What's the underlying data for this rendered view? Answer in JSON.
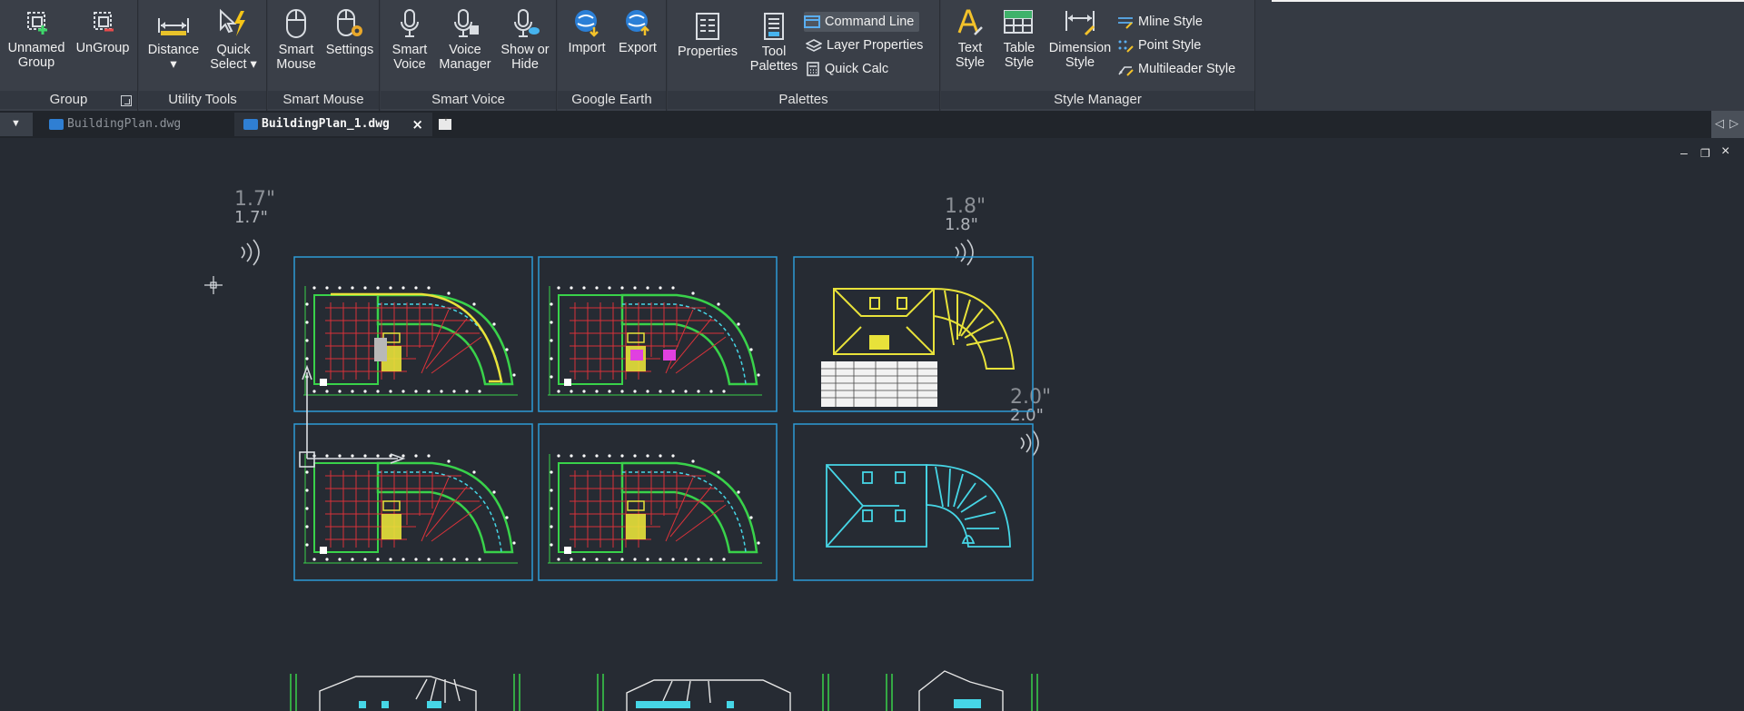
{
  "ribbon": {
    "panels": [
      {
        "title": "Group"
      },
      {
        "title": "Utility Tools"
      },
      {
        "title": "Smart Mouse"
      },
      {
        "title": "Smart Voice"
      },
      {
        "title": "Google Earth"
      },
      {
        "title": "Palettes"
      },
      {
        "title": "Style Manager"
      }
    ],
    "tools": {
      "unnamed_group": "Unnamed\nGroup",
      "ungroup": "UnGroup",
      "distance": "Distance\n▾",
      "quick_select": "Quick\nSelect ▾",
      "smart_mouse": "Smart\nMouse",
      "settings": "Settings",
      "smart_voice": "Smart\nVoice",
      "voice_manager": "Voice\nManager",
      "show_or_hide": "Show or\nHide",
      "import": "Import",
      "export": "Export",
      "properties": "Properties",
      "tool_palettes": "Tool\nPalettes",
      "command_line": "Command Line",
      "layer_properties": "Layer Properties",
      "quick_calc": "Quick Calc",
      "text_style": "Text\nStyle",
      "table_style": "Table\nStyle",
      "dimension_style": "Dimension\nStyle",
      "mline_style": "Mline Style",
      "point_style": "Point Style",
      "multileader_style": "Multileader Style"
    }
  },
  "tabs": [
    {
      "label": "BuildingPlan.dwg"
    },
    {
      "label": "BuildingPlan_1.dwg"
    }
  ],
  "window_controls": {
    "minimize": "–",
    "restore": "❐",
    "close": "×"
  },
  "annotations": [
    {
      "main": "1.7\"",
      "sub": "1.7\""
    },
    {
      "main": "1.8\"",
      "sub": "1.8\""
    },
    {
      "main": "2.0\"",
      "sub": "2.0\""
    }
  ],
  "colors": {
    "ribbon_bg": "#353a43",
    "canvas_bg": "#262b33",
    "viewport_border": "#2d9bd6",
    "plan_green": "#39d24a",
    "plan_red": "#d8323a",
    "plan_yellow": "#e8e23a",
    "plan_cyan": "#46d6e6",
    "plan_magenta": "#e040e0"
  }
}
